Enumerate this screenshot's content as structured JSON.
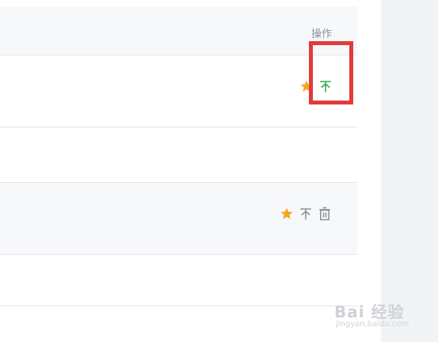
{
  "header": {
    "actions_label": "操作"
  },
  "rows": [
    {
      "actions": [
        "star-icon",
        "pin-to-top-icon"
      ],
      "highlighted": true
    },
    {
      "actions": []
    },
    {
      "actions": [
        "star-icon",
        "pin-to-top-icon",
        "delete-icon"
      ]
    },
    {
      "actions": []
    }
  ],
  "colors": {
    "star": "#f5a623",
    "pin_active": "#2aa84a",
    "icon_gray": "#8a8f99",
    "highlight": "#e33a3a",
    "header_bg": "#f7f8fa",
    "divider": "#e4e6ea",
    "side_panel": "#f2f3f5"
  },
  "watermark": {
    "brand": "Bai 经验",
    "url": "jingyan.baidu.com"
  }
}
